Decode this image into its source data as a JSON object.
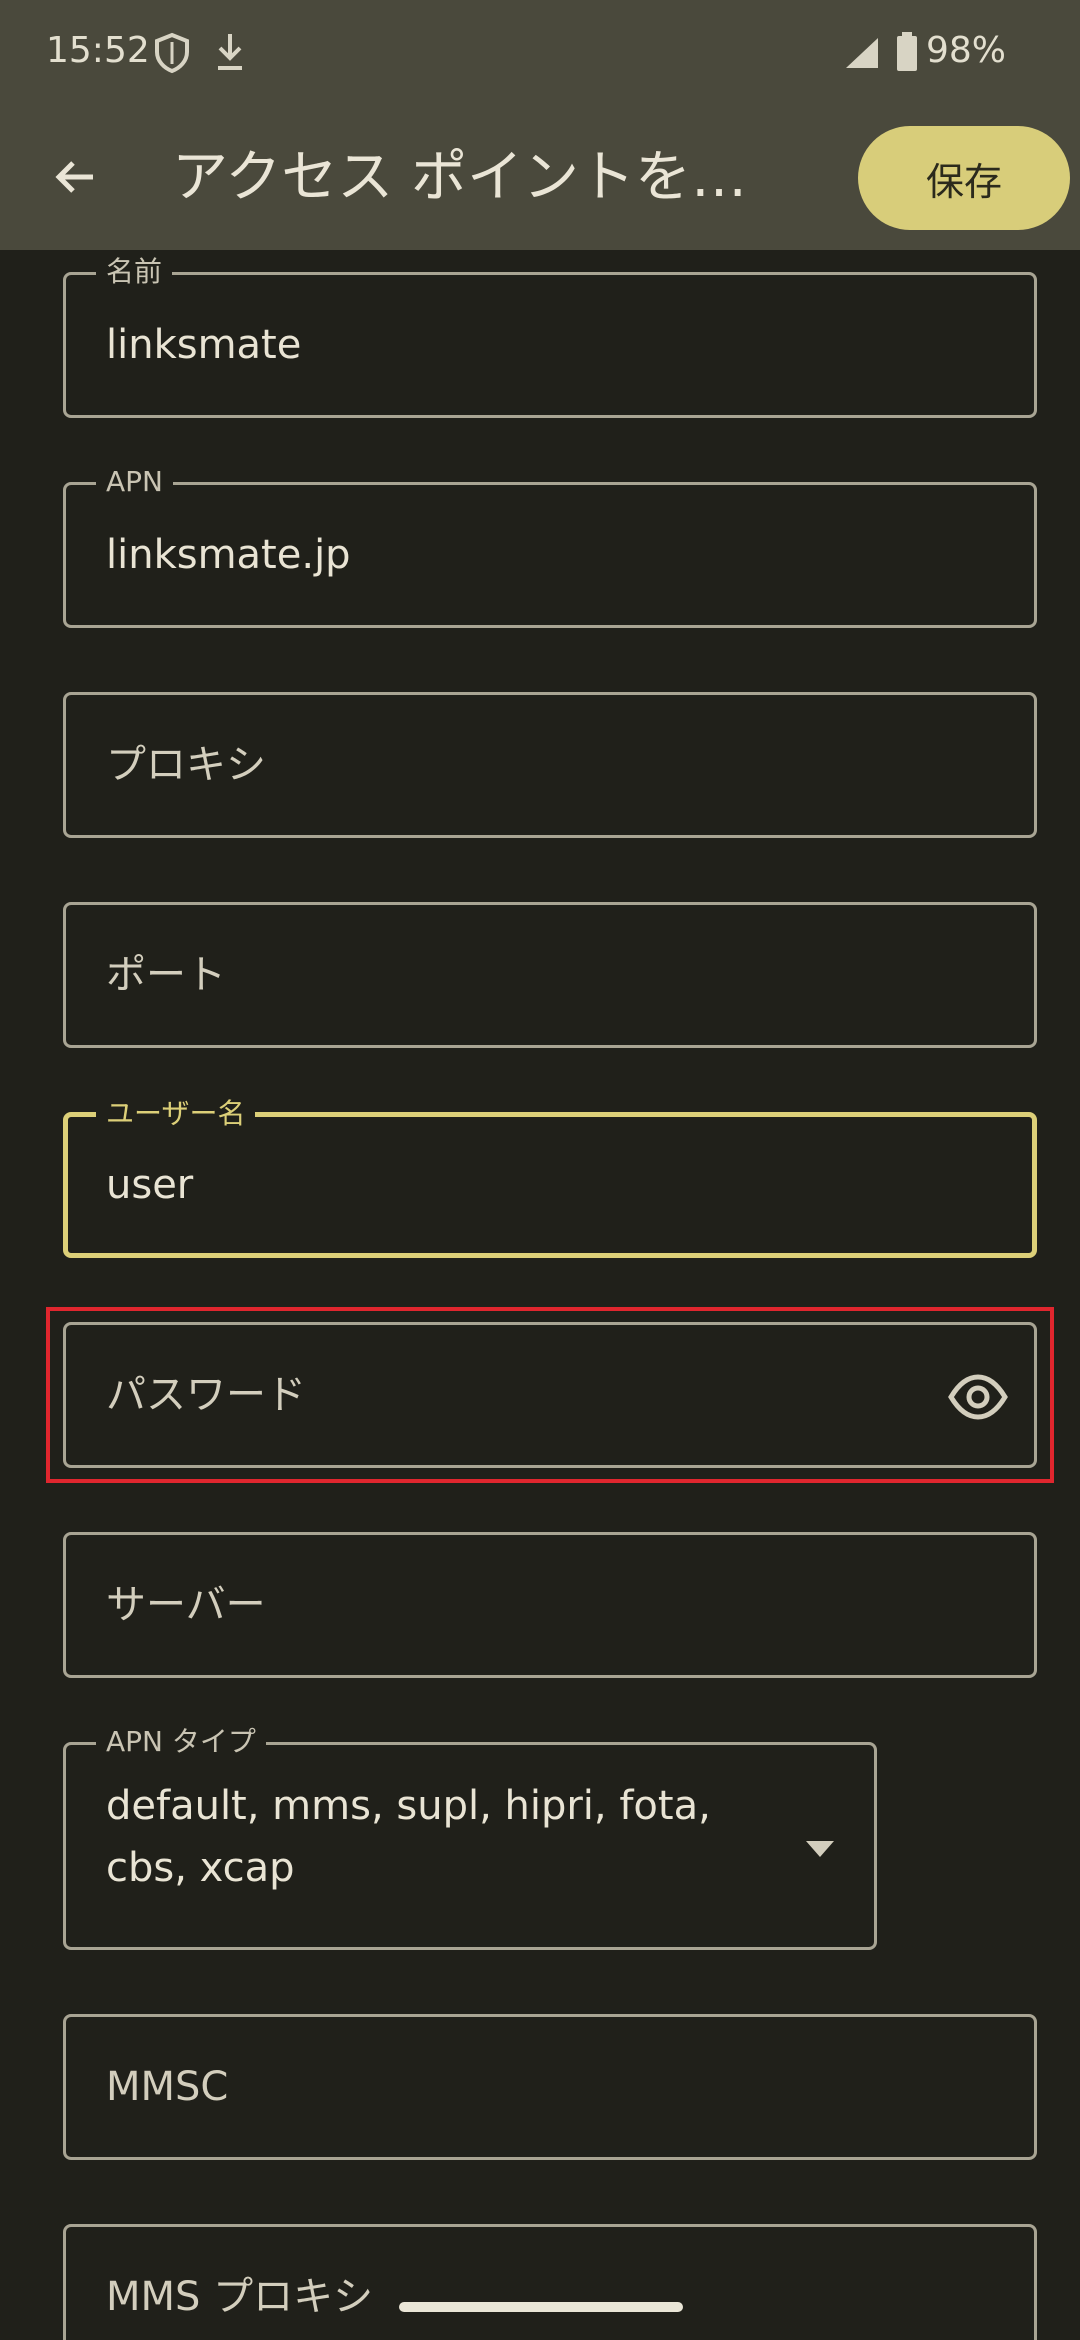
{
  "status_bar": {
    "time": "15:52",
    "battery_percent": "98%",
    "icons": [
      "shield-icon",
      "download-icon",
      "signal-icon",
      "battery-icon"
    ]
  },
  "toolbar": {
    "title": "アクセス ポイントを…",
    "save_label": "保存",
    "back_icon": "arrow-left-icon"
  },
  "fields": {
    "name": {
      "label": "名前",
      "value": "linksmate"
    },
    "apn": {
      "label": "APN",
      "value": "linksmate.jp"
    },
    "proxy": {
      "placeholder": "プロキシ"
    },
    "port": {
      "placeholder": "ポート"
    },
    "username": {
      "label": "ユーザー名",
      "value": "user"
    },
    "password": {
      "placeholder": "パスワード",
      "icon": "eye-icon"
    },
    "server": {
      "placeholder": "サーバー"
    },
    "apn_type": {
      "label": "APN タイプ",
      "value": "default, mms, supl, hipri, fota, cbs, xcap"
    },
    "mmsc": {
      "placeholder": "MMSC"
    },
    "mms_proxy": {
      "placeholder": "MMS プロキシ"
    }
  },
  "colors": {
    "background": "#20201a",
    "header": "#4a493c",
    "accent": "#dccf78",
    "save_button": "#d8cd7a",
    "outline": "#a8a493",
    "highlight": "#e0262e"
  }
}
